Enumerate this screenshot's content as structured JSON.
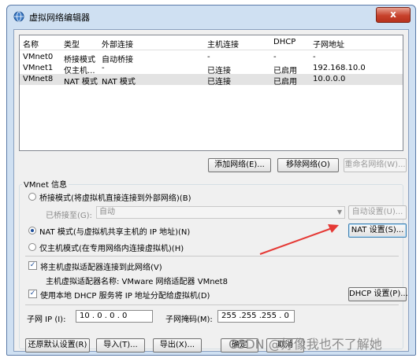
{
  "window": {
    "title": "虚拟网络编辑器",
    "close_label": "x"
  },
  "table": {
    "headers": [
      "名称",
      "类型",
      "外部连接",
      "主机连接",
      "DHCP",
      "子网地址"
    ],
    "rows": [
      [
        "VMnet0",
        "桥接模式",
        "自动桥接",
        "-",
        "-",
        "-"
      ],
      [
        "VMnet1",
        "仅主机...",
        "-",
        "已连接",
        "已启用",
        "192.168.10.0"
      ],
      [
        "VMnet8",
        "NAT 模式",
        "NAT 模式",
        "已连接",
        "已启用",
        "10.0.0.0"
      ]
    ],
    "selected_row": 2
  },
  "table_buttons": {
    "add": "添加网络(E)...",
    "remove": "移除网络(O)",
    "rename": "重命名网络(W)..."
  },
  "vmnet_info": {
    "group_label": "VMnet 信息",
    "bridge_mode": "桥接模式(将虚拟机直接连接到外部网络)(B)",
    "bridged_to_label": "已桥接至(G):",
    "bridged_to_value": "自动",
    "auto_settings": "自动设置(U)...",
    "nat_mode": "NAT 模式(与虚拟机共享主机的 IP 地址)(N)",
    "nat_settings": "NAT 设置(S)...",
    "host_only_mode": "仅主机模式(在专用网络内连接虚拟机)(H)",
    "selected_mode": "nat",
    "connect_adapter": "将主机虚拟适配器连接到此网络(V)",
    "adapter_name": "主机虚拟适配器名称: VMware 网络适配器 VMnet8",
    "use_dhcp": "使用本地 DHCP 服务将 IP 地址分配给虚拟机(D)",
    "dhcp_settings": "DHCP 设置(P)...",
    "subnet_ip_label": "子网 IP (I):",
    "subnet_ip_value": "10 . 0 . 0 . 0",
    "subnet_mask_label": "子网掩码(M):",
    "subnet_mask_value": "255 .255 .255 . 0"
  },
  "bottom_buttons": {
    "restore": "还原默认设置(R)",
    "import": "导入(T)...",
    "export": "导出(X)...",
    "ok": "确定",
    "cancel": "取消"
  },
  "watermark": "CSDN @好像我也不了解她",
  "colors": {
    "annotation_arrow": "#e53935",
    "title_bar": "#cfe0f2",
    "close_button": "#c7412b"
  }
}
